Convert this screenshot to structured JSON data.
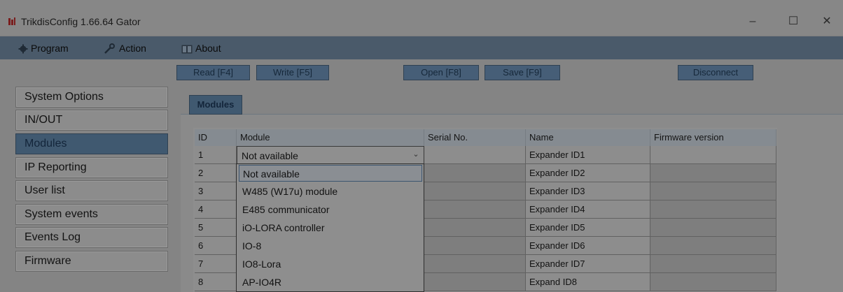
{
  "window": {
    "title": "TrikdisConfig 1.66.64   Gator",
    "minimize_glyph": "–",
    "maximize_glyph": "☐",
    "close_glyph": "✕"
  },
  "menu": {
    "program": "Program",
    "action": "Action",
    "about": "About",
    "program_icon": "gear-icon",
    "action_icon": "wrench-icon",
    "about_icon": "book-icon"
  },
  "toolbar": {
    "read": "Read [F4]",
    "write": "Write [F5]",
    "open": "Open [F8]",
    "save": "Save [F9]",
    "disconnect": "Disconnect"
  },
  "nav": {
    "items": [
      "System Options",
      "IN/OUT",
      "Modules",
      "IP Reporting",
      "User list",
      "System events",
      "Events Log",
      "Firmware"
    ],
    "active": "Modules"
  },
  "tab": {
    "label": "Modules"
  },
  "table": {
    "headers": [
      "ID",
      "Module",
      "Serial No.",
      "Name",
      "Firmware version"
    ],
    "rows": [
      {
        "id": "1",
        "name": "Expander ID1"
      },
      {
        "id": "2",
        "name": "Expander ID2"
      },
      {
        "id": "3",
        "name": "Expander ID3"
      },
      {
        "id": "4",
        "name": "Expander ID4"
      },
      {
        "id": "5",
        "name": "Expander ID5"
      },
      {
        "id": "6",
        "name": "Expander ID6"
      },
      {
        "id": "7",
        "name": "Expander ID7"
      },
      {
        "id": "8",
        "name": "Expand ID8"
      }
    ]
  },
  "combo": {
    "value": "Not available",
    "arrow": "⌄"
  },
  "dropdown": {
    "options": [
      "Not available",
      "W485 (W17u) module",
      "E485 communicator",
      "iO-LORA controller",
      "IO-8",
      "IO8-Lora",
      "AP-IO4R"
    ],
    "selected": "Not available"
  },
  "colors": {
    "accent": "#405970",
    "overlay": "#848484"
  }
}
